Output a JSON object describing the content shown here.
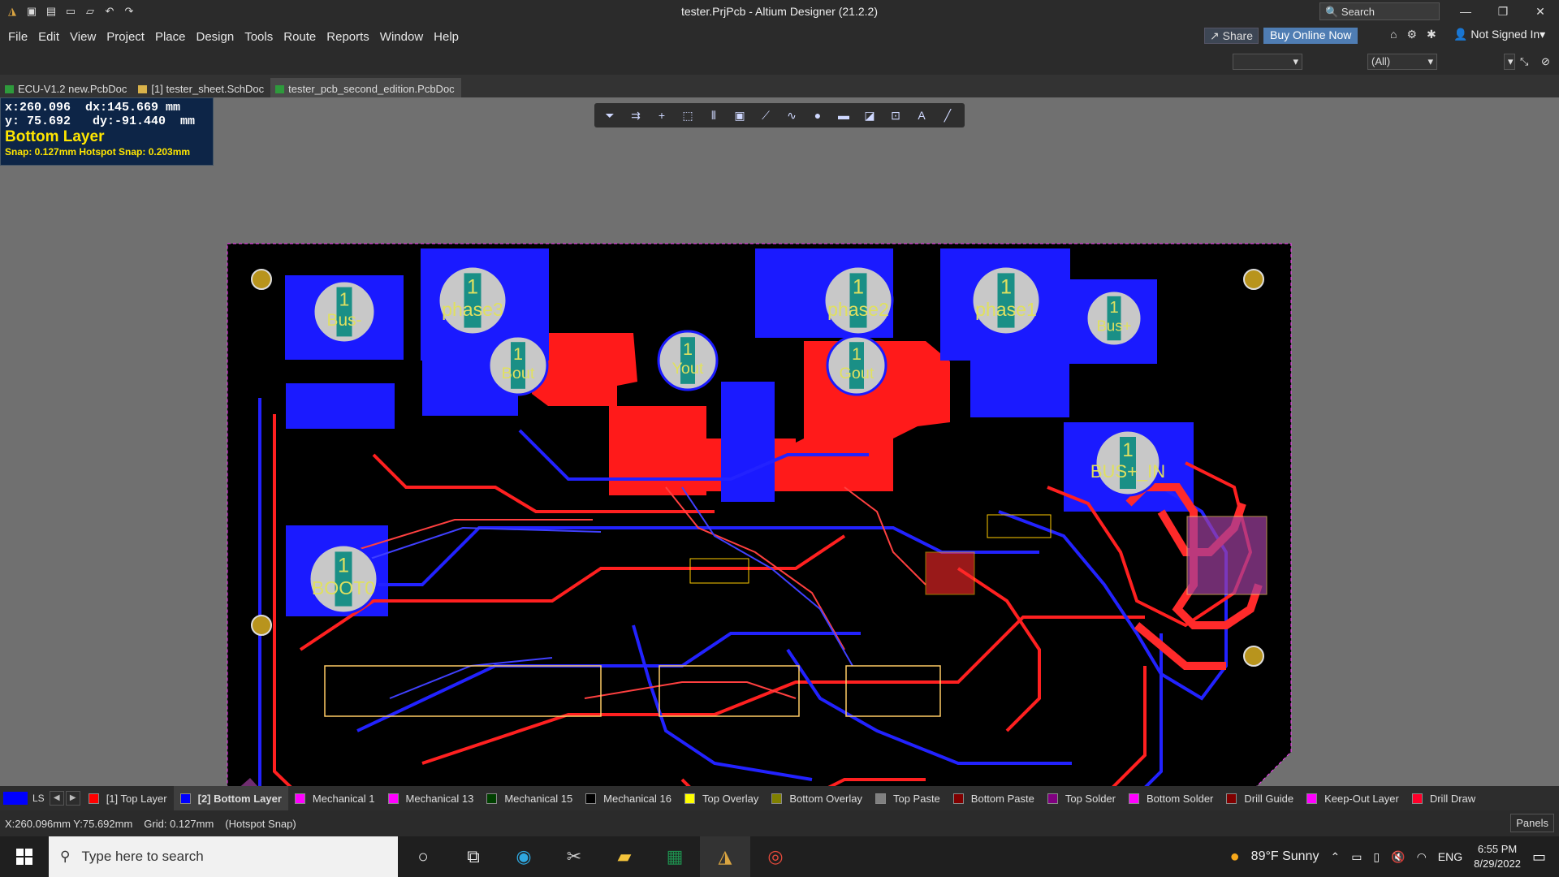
{
  "window": {
    "title": "tester.PrjPcb - Altium Designer (21.2.2)",
    "search_placeholder": "Search"
  },
  "menu": [
    "File",
    "Edit",
    "View",
    "Project",
    "Place",
    "Design",
    "Tools",
    "Route",
    "Reports",
    "Window",
    "Help"
  ],
  "top_right": {
    "share": "Share",
    "buy": "Buy Online Now",
    "signed": "Not Signed In"
  },
  "filter": {
    "value": "(All)"
  },
  "tabs": [
    {
      "label": "ECU-V1.2 new.PcbDoc",
      "icon_color": "#2e9a3c"
    },
    {
      "label": "[1] tester_sheet.SchDoc",
      "icon_color": "#d9b24a"
    },
    {
      "label": "tester_pcb_second_edition.PcbDoc",
      "icon_color": "#2e9a3c"
    }
  ],
  "hud": {
    "xline": "x:260.096  dx:145.669 mm",
    "yline": "y: 75.692   dy:-91.440  mm",
    "layer": "Bottom Layer",
    "snap": "Snap: 0.127mm Hotspot Snap: 0.203mm"
  },
  "board": {
    "pads": [
      {
        "label": "Bus-"
      },
      {
        "label": "phase3"
      },
      {
        "label": "phase2"
      },
      {
        "label": "phase1"
      },
      {
        "label": "Bus+"
      },
      {
        "label": "Bout"
      },
      {
        "label": "Yout"
      },
      {
        "label": "Gout"
      },
      {
        "label": "BOOT0"
      },
      {
        "label": "BUS+_IN"
      }
    ],
    "pad_number": "1"
  },
  "layers": {
    "ls": "LS",
    "items": [
      {
        "label": "[1] Top Layer",
        "color": "#ff0000"
      },
      {
        "label": "[2] Bottom Layer",
        "color": "#0000ff"
      },
      {
        "label": "Mechanical 1",
        "color": "#ff00ff"
      },
      {
        "label": "Mechanical 13",
        "color": "#ff00ff"
      },
      {
        "label": "Mechanical 15",
        "color": "#004000"
      },
      {
        "label": "Mechanical 16",
        "color": "#000000"
      },
      {
        "label": "Top Overlay",
        "color": "#ffff00"
      },
      {
        "label": "Bottom Overlay",
        "color": "#808000"
      },
      {
        "label": "Top Paste",
        "color": "#808080"
      },
      {
        "label": "Bottom Paste",
        "color": "#800000"
      },
      {
        "label": "Top Solder",
        "color": "#800080"
      },
      {
        "label": "Bottom Solder",
        "color": "#ff00ff"
      },
      {
        "label": "Drill Guide",
        "color": "#800000"
      },
      {
        "label": "Keep-Out Layer",
        "color": "#ff00ff"
      },
      {
        "label": "Drill Draw",
        "color": "#ff002a"
      }
    ]
  },
  "status": {
    "coords": "X:260.096mm Y:75.692mm",
    "grid": "Grid: 0.127mm",
    "snap": "(Hotspot Snap)",
    "panels": "Panels"
  },
  "taskbar": {
    "search": "Type here to search",
    "weather": "89°F  Sunny",
    "lang": "ENG",
    "time": "6:55 PM",
    "date": "8/29/2022"
  }
}
